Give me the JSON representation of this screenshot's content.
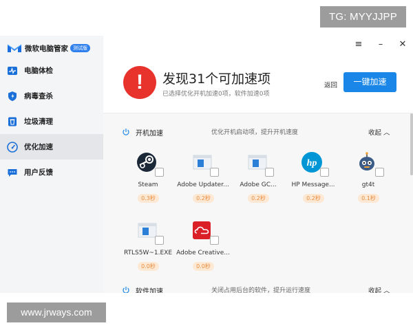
{
  "watermarks": {
    "tg": "TG: MYYJJPP",
    "site": "www.jrways.com"
  },
  "brand": {
    "name": "微软电脑管家",
    "badge": "测试版"
  },
  "sidebar": {
    "items": [
      {
        "label": "电脑体检",
        "icon": "pulse-icon",
        "active": false
      },
      {
        "label": "病毒查杀",
        "icon": "shield-icon",
        "active": false
      },
      {
        "label": "垃圾清理",
        "icon": "trash-icon",
        "active": false
      },
      {
        "label": "优化加速",
        "icon": "speedometer-icon",
        "active": true
      },
      {
        "label": "用户反馈",
        "icon": "chat-icon",
        "active": false
      }
    ]
  },
  "window_controls": {
    "menu": "≡",
    "minimize": "–",
    "close": "✕"
  },
  "summary": {
    "alert_glyph": "!",
    "headline": "发现31个可加速项",
    "subline": "已选择优化开机加速0项，软件加速0项",
    "back_label": "返回",
    "accelerate_label": "一键加速"
  },
  "startup_section": {
    "title": "开机加速",
    "description": "优化开机启动项，提升开机速度",
    "collapse_label": "收起 ︿",
    "apps": [
      {
        "name": "Steam",
        "time": "0.3秒",
        "icon": "steam-icon"
      },
      {
        "name": "Adobe Updater...",
        "time": "0.2秒",
        "icon": "generic-app-icon"
      },
      {
        "name": "Adobe GC...",
        "time": "0.2秒",
        "icon": "generic-app-icon"
      },
      {
        "name": "HP Message...",
        "time": "0.2秒",
        "icon": "hp-icon"
      },
      {
        "name": "gt4t",
        "time": "0.1秒",
        "icon": "robot-icon"
      },
      {
        "name": "RTLS5W~1.EXE",
        "time": "0.0秒",
        "icon": "generic-app-icon"
      },
      {
        "name": "Adobe Creative...",
        "time": "0.0秒",
        "icon": "creative-cloud-icon"
      }
    ]
  },
  "software_section": {
    "title": "软件加速",
    "description": "关闭占用后台的软件，提升运行速度",
    "collapse_label": "收起 ︿"
  },
  "colors": {
    "accent": "#1a87e8",
    "alert": "#e8322c",
    "time_badge_bg": "#fde8d3",
    "time_badge_text": "#e88b3d",
    "sidebar_bg": "#f4f5f7"
  }
}
